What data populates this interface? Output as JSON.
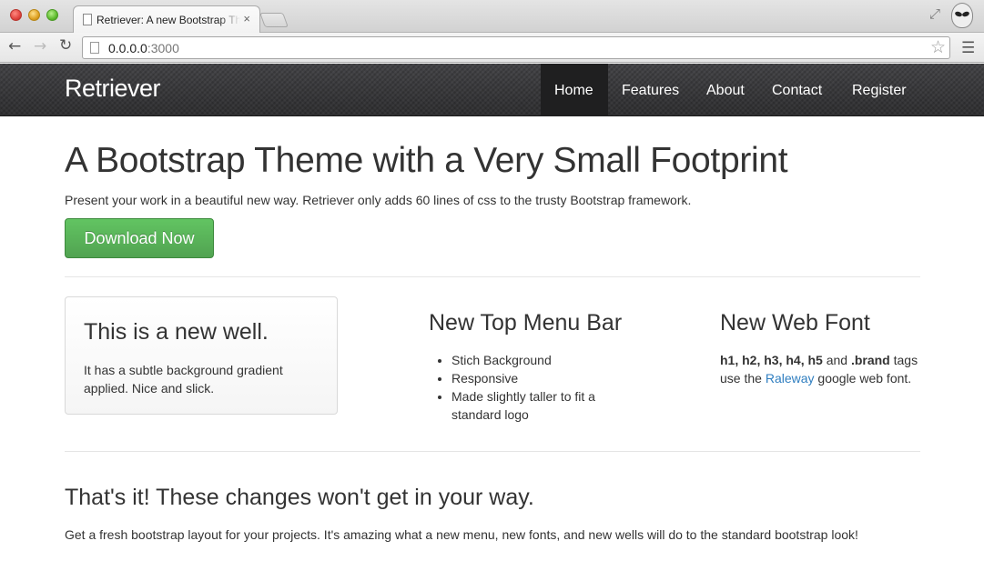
{
  "browser": {
    "tab_title": "Retriever: A new Bootstrap Theme",
    "tab_close": "×",
    "url_host": "0.0.0.0",
    "url_port": ":3000"
  },
  "navbar": {
    "brand": "Retriever",
    "items": [
      {
        "label": "Home",
        "active": true
      },
      {
        "label": "Features"
      },
      {
        "label": "About"
      },
      {
        "label": "Contact"
      },
      {
        "label": "Register"
      }
    ]
  },
  "hero": {
    "title": "A Bootstrap Theme with a Very Small Footprint",
    "lead": "Present your work in a beautiful new way. Retriever only adds 60 lines of css to the trusty Bootstrap framework.",
    "button_label": "Download Now"
  },
  "well": {
    "title": "This is a new well.",
    "text": "It has a subtle background gradient applied. Nice and slick."
  },
  "menu_bar": {
    "title": "New Top Menu Bar",
    "items": [
      "Stich Background",
      "Responsive",
      "Made slightly taller to fit a standard logo"
    ]
  },
  "web_font": {
    "title": "New Web Font",
    "tags": "h1, h2, h3, h4, h5",
    "and": " and ",
    "brand": ".brand",
    "tags_suffix": " tags use the ",
    "link": "Raleway",
    "suffix": " google web font."
  },
  "footer_section": {
    "title": "That's it! These changes won't get in your way.",
    "text": "Get a fresh bootstrap layout for your projects. It's amazing what a new menu, new fonts, and new wells will do to the standard bootstrap look!"
  },
  "colors": {
    "accent_green": "#5bb75b",
    "navbar": "#3a3a3d",
    "link": "#2f7ec0"
  }
}
